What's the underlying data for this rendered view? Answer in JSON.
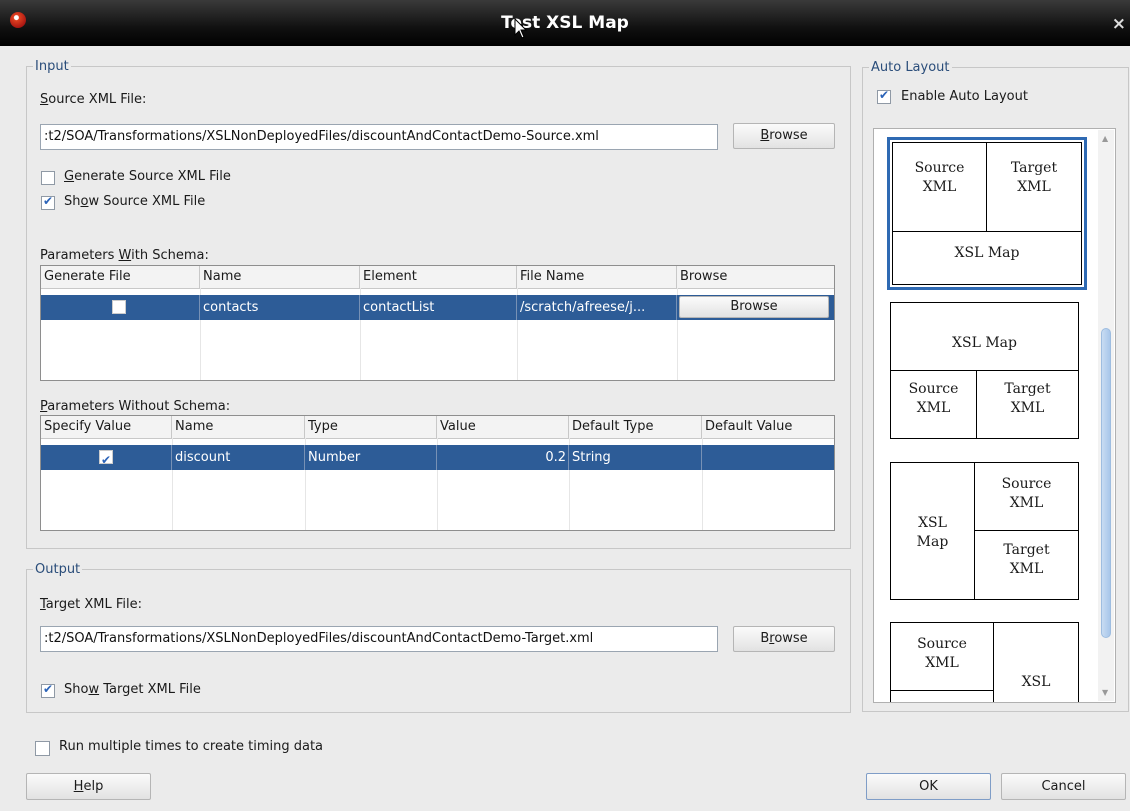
{
  "window": {
    "title": "Test XSL Map",
    "close_glyph": "×"
  },
  "input": {
    "legend": "Input",
    "source_label_accel": "S",
    "source_label_rest": "ource XML File:",
    "source_path": ":t2/SOA/Transformations/XSLNonDeployedFiles/discountAndContactDemo-Source.xml",
    "browse_accel": "B",
    "browse_rest": "rowse",
    "generate_accel": "G",
    "generate_rest": "enerate Source XML File",
    "generate_checked": false,
    "show_source_pre": "Sh",
    "show_source_accel": "o",
    "show_source_rest": "w Source XML File",
    "show_source_checked": true
  },
  "params_with_schema": {
    "label_pre": "Parameters ",
    "label_accel": "W",
    "label_rest": "ith Schema:",
    "columns": [
      "Generate File",
      "Name",
      "Element",
      "File Name",
      "Browse"
    ],
    "rows": [
      {
        "generate": false,
        "name": "contacts",
        "element": "contactList",
        "file_name": "/scratch/afreese/j...",
        "browse": "Browse"
      }
    ]
  },
  "params_without_schema": {
    "label_accel": "P",
    "label_rest": "arameters Without Schema:",
    "columns": [
      "Specify Value",
      "Name",
      "Type",
      "Value",
      "Default Type",
      "Default Value"
    ],
    "rows": [
      {
        "specify": true,
        "name": "discount",
        "type": "Number",
        "value": "0.2",
        "default_type": "String",
        "default_value": ""
      }
    ]
  },
  "output": {
    "legend": "Output",
    "target_label_accel": "T",
    "target_label_rest": "arget XML File:",
    "target_path": ":t2/SOA/Transformations/XSLNonDeployedFiles/discountAndContactDemo-Target.xml",
    "browse_pre": "B",
    "browse_accel": "r",
    "browse_rest": "owse",
    "show_target_pre": "Sho",
    "show_target_accel": "w",
    "show_target_rest": " Target XML File",
    "show_target_checked": true
  },
  "auto_layout": {
    "legend": "Auto Layout",
    "enable_label": "Enable Auto Layout",
    "enable_checked": true,
    "layouts": [
      {
        "source": "Source XML",
        "target": "Target XML",
        "map": "XSL Map"
      },
      {
        "map": "XSL Map",
        "source": "Source XML",
        "target": "Target XML"
      },
      {
        "map": "XSL Map",
        "source": "Source XML",
        "target": "Target XML"
      },
      {
        "source": "Source XML",
        "map": "XSL"
      }
    ]
  },
  "footer": {
    "timing_label": "Run multiple times to create timing data",
    "timing_checked": false,
    "help_accel": "H",
    "help_rest": "elp",
    "ok": "OK",
    "cancel": "Cancel"
  },
  "colors": {
    "selection": "#2d5c97",
    "legend_text": "#2a4d7a",
    "titlebar": "#000000"
  }
}
